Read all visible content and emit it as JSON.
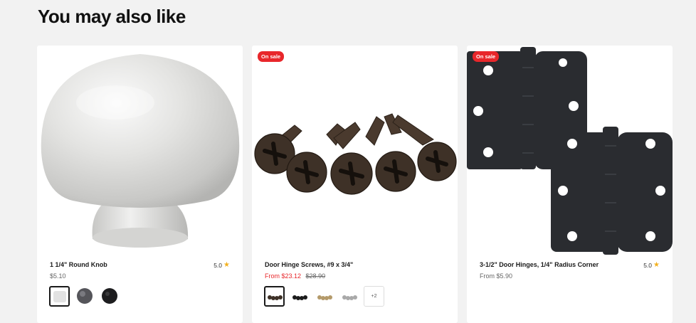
{
  "section": {
    "title": "You may also like"
  },
  "products": [
    {
      "title": "1 1/4\" Round Knob",
      "rating": "5.0",
      "price": "$5.10"
    },
    {
      "badge": "On sale",
      "title": "Door Hinge Screws, #9 x 3/4\"",
      "price_sale": "From $23.12",
      "price_old": "$28.90",
      "swatch_more": "+2"
    },
    {
      "badge": "On sale",
      "title": "3-1/2\" Door Hinges, 1/4\" Radius Corner",
      "rating": "5.0",
      "price": "From $5.90"
    }
  ],
  "colors": {
    "accent": "#e8272b",
    "star": "#f2b01e",
    "background": "#f2f2f2"
  },
  "icons": {
    "rating": "star-icon"
  }
}
